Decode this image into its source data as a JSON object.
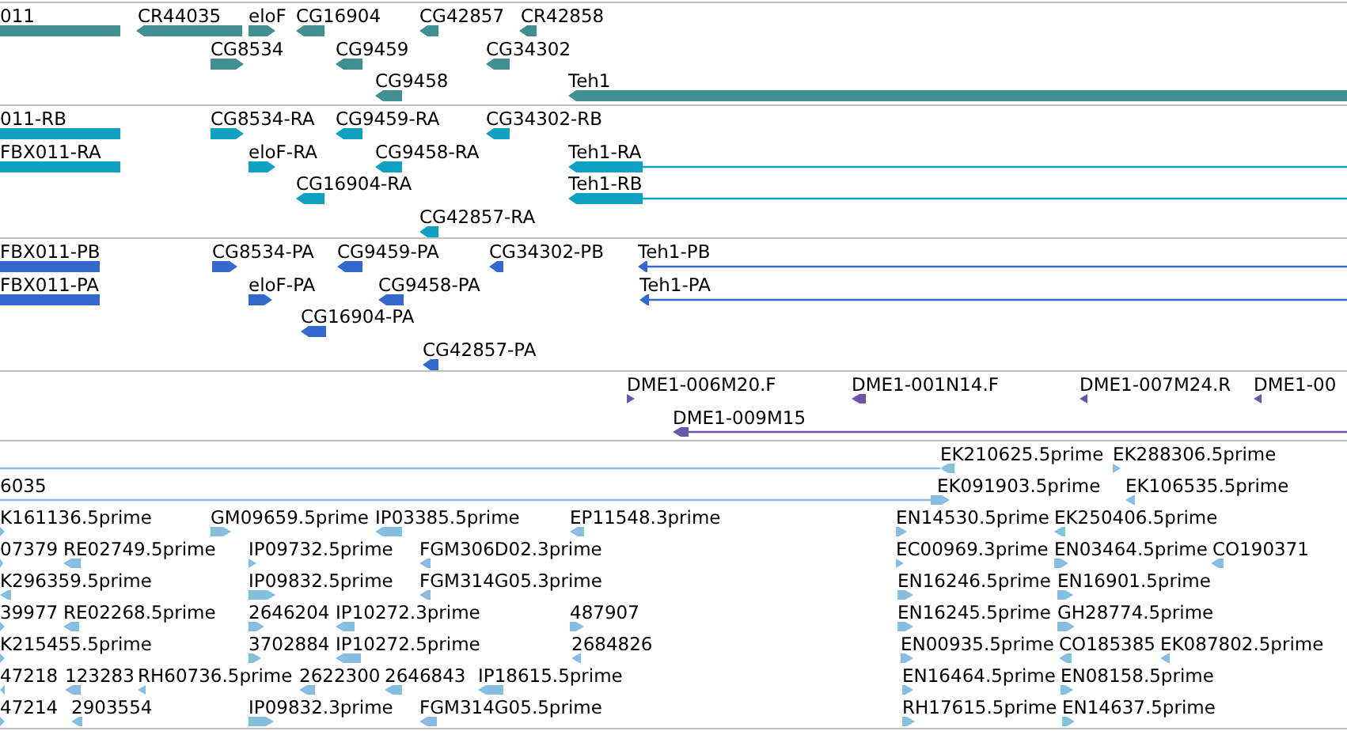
{
  "tracks": [
    {
      "kind": "gene",
      "color": "#418f91",
      "lanes": [
        {
          "features": [
            {
              "label": "011",
              "reverse": true
            },
            {
              "label": "CR44035",
              "reverse": true
            },
            {
              "label": "eloF",
              "reverse": false
            },
            {
              "label": "CG16904",
              "reverse": true
            },
            {
              "label": "CG42857",
              "reverse": true
            },
            {
              "label": "CR42858",
              "reverse": true
            }
          ]
        },
        {
          "features": [
            {
              "label": "CG8534",
              "reverse": false
            },
            {
              "label": "CG9459",
              "reverse": true
            },
            {
              "label": "CG34302",
              "reverse": true
            }
          ]
        },
        {
          "features": [
            {
              "label": "CG9458",
              "reverse": true
            },
            {
              "label": "Teh1",
              "reverse": true
            }
          ]
        }
      ]
    },
    {
      "kind": "transcript",
      "color": "#0fa0c2",
      "lanes": [
        {
          "features": [
            {
              "label": "011-RB",
              "reverse": true
            },
            {
              "label": "CG8534-RA",
              "reverse": false
            },
            {
              "label": "CG9459-RA",
              "reverse": true
            },
            {
              "label": "CG34302-RB",
              "reverse": true
            }
          ]
        },
        {
          "features": [
            {
              "label": "FBX011-RA",
              "reverse": true
            },
            {
              "label": "eloF-RA",
              "reverse": false
            },
            {
              "label": "CG9458-RA",
              "reverse": true
            },
            {
              "label": "Teh1-RA",
              "reverse": true
            }
          ]
        },
        {
          "features": [
            {
              "label": "CG16904-RA",
              "reverse": true
            },
            {
              "label": "Teh1-RB",
              "reverse": true
            }
          ]
        },
        {
          "features": [
            {
              "label": "CG42857-RA",
              "reverse": true
            }
          ]
        }
      ]
    },
    {
      "kind": "protein",
      "color": "#3468cc",
      "lanes": [
        {
          "features": [
            {
              "label": "FBX011-PB",
              "reverse": true
            },
            {
              "label": "CG8534-PA",
              "reverse": false
            },
            {
              "label": "CG9459-PA",
              "reverse": true
            },
            {
              "label": "CG34302-PB",
              "reverse": true
            },
            {
              "label": "Teh1-PB",
              "reverse": true
            }
          ]
        },
        {
          "features": [
            {
              "label": "FBX011-PA",
              "reverse": true
            },
            {
              "label": "eloF-PA",
              "reverse": false
            },
            {
              "label": "CG9458-PA",
              "reverse": true
            },
            {
              "label": "Teh1-PA",
              "reverse": true
            }
          ]
        },
        {
          "features": [
            {
              "label": "CG16904-PA",
              "reverse": true
            }
          ]
        },
        {
          "features": [
            {
              "label": "CG42857-PA",
              "reverse": true
            }
          ]
        }
      ]
    },
    {
      "kind": "clone",
      "color": "#6b55a8",
      "lanes": [
        {
          "features": [
            {
              "label": "DME1-006M20.F",
              "reverse": false
            },
            {
              "label": "DME1-001N14.F",
              "reverse": true
            },
            {
              "label": "DME1-007M24.R",
              "reverse": true
            },
            {
              "label": "DME1-00",
              "reverse": true
            }
          ]
        },
        {
          "features": [
            {
              "label": "DME1-009M15",
              "reverse": true
            }
          ]
        }
      ]
    },
    {
      "kind": "est",
      "color": "#86bde0",
      "lanes": [
        {
          "features": [
            {
              "label": "EK210625.5prime",
              "reverse": true
            },
            {
              "label": "EK288306.5prime",
              "reverse": false
            }
          ]
        },
        {
          "features": [
            {
              "label": "6035"
            },
            {
              "label": "EK091903.5prime",
              "reverse": false
            },
            {
              "label": "EK106535.5prime",
              "reverse": true
            }
          ]
        },
        {
          "features": [
            {
              "label": "K161136.5prime",
              "reverse": false
            },
            {
              "label": "GM09659.5prime",
              "reverse": false
            },
            {
              "label": "IP03385.5prime",
              "reverse": true
            },
            {
              "label": "EP11548.3prime",
              "reverse": true
            },
            {
              "label": "EN14530.5prime",
              "reverse": false
            },
            {
              "label": "EK250406.5prime",
              "reverse": true
            }
          ]
        },
        {
          "features": [
            {
              "label": "07379",
              "reverse": false
            },
            {
              "label": "RE02749.5prime",
              "reverse": true
            },
            {
              "label": "IP09732.5prime",
              "reverse": false
            },
            {
              "label": "FGM306D02.3prime",
              "reverse": true
            },
            {
              "label": "EC00969.3prime",
              "reverse": false
            },
            {
              "label": "EN03464.5prime",
              "reverse": false
            },
            {
              "label": "CO190371",
              "reverse": true
            }
          ]
        },
        {
          "features": [
            {
              "label": "K296359.5prime",
              "reverse": true
            },
            {
              "label": "IP09832.5prime",
              "reverse": false
            },
            {
              "label": "FGM314G05.3prime",
              "reverse": true
            },
            {
              "label": "EN16246.5prime",
              "reverse": false
            },
            {
              "label": "EN16901.5prime",
              "reverse": false
            }
          ]
        },
        {
          "features": [
            {
              "label": "39977",
              "reverse": false
            },
            {
              "label": "RE02268.5prime",
              "reverse": true
            },
            {
              "label": "2646204",
              "reverse": false
            },
            {
              "label": "IP10272.3prime",
              "reverse": true
            },
            {
              "label": "487907",
              "reverse": false
            },
            {
              "label": "EN16245.5prime",
              "reverse": false
            },
            {
              "label": "GH28774.5prime",
              "reverse": false
            }
          ]
        },
        {
          "features": [
            {
              "label": "K215455.5prime",
              "reverse": false
            },
            {
              "label": "3702884",
              "reverse": false
            },
            {
              "label": "IP10272.5prime",
              "reverse": true
            },
            {
              "label": "2684826",
              "reverse": true
            },
            {
              "label": "EN00935.5prime",
              "reverse": false
            },
            {
              "label": "CO185385",
              "reverse": true
            },
            {
              "label": "EK087802.5prime",
              "reverse": true
            }
          ]
        },
        {
          "features": [
            {
              "label": "47218",
              "reverse": true
            },
            {
              "label": "123283",
              "reverse": true
            },
            {
              "label": "RH60736.5prime",
              "reverse": true
            },
            {
              "label": "2622300",
              "reverse": true
            },
            {
              "label": "2646843",
              "reverse": true
            },
            {
              "label": "IP18615.5prime",
              "reverse": true
            },
            {
              "label": "EN16464.5prime",
              "reverse": false
            },
            {
              "label": "EN08158.5prime",
              "reverse": false
            }
          ]
        },
        {
          "features": [
            {
              "label": "47214",
              "reverse": false
            },
            {
              "label": "2903554",
              "reverse": true
            },
            {
              "label": "IP09832.3prime",
              "reverse": false
            },
            {
              "label": "FGM314G05.5prime",
              "reverse": true
            },
            {
              "label": "RH17615.5prime",
              "reverse": false
            },
            {
              "label": "EN14637.5prime",
              "reverse": false
            }
          ]
        }
      ]
    }
  ]
}
